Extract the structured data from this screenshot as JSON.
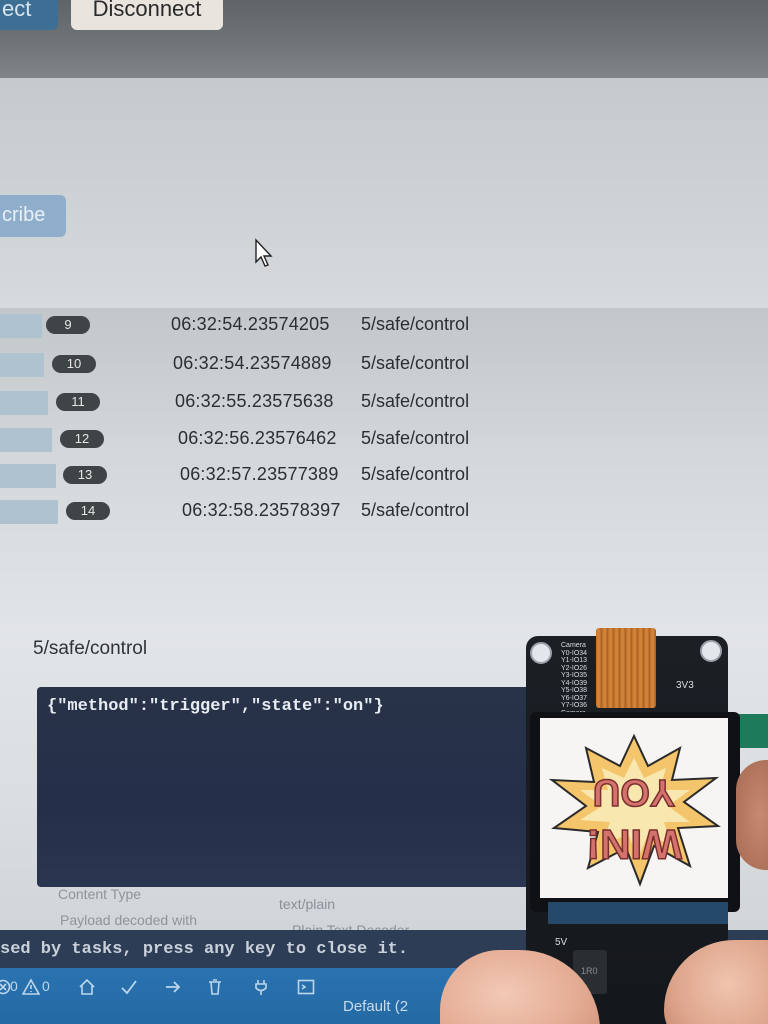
{
  "toolbar": {
    "connect_label": "ect",
    "disconnect_label": "Disconnect",
    "subscribe_label": "cribe"
  },
  "messages": [
    {
      "index": "9",
      "time": "06:32:54.23574205",
      "topic": "5/safe/control"
    },
    {
      "index": "10",
      "time": "06:32:54.23574889",
      "topic": "5/safe/control"
    },
    {
      "index": "11",
      "time": "06:32:55.23575638",
      "topic": "5/safe/control"
    },
    {
      "index": "12",
      "time": "06:32:56.23576462",
      "topic": "5/safe/control"
    },
    {
      "index": "13",
      "time": "06:32:57.23577389",
      "topic": "5/safe/control"
    },
    {
      "index": "14",
      "time": "06:32:58.23578397",
      "topic": "5/safe/control"
    }
  ],
  "payload": {
    "topic": "5/safe/control",
    "body": "{\"method\":\"trigger\",\"state\":\"on\"}",
    "content_type_label": "Content Type",
    "content_type_value": "text/plain",
    "decoded_label": "Payload decoded with",
    "decoded_value": "Plain Text Decoder"
  },
  "terminal": {
    "text": "sed by tasks, press any key to close it."
  },
  "statusbar": {
    "problems": "0",
    "warnings": "0",
    "profile": "Default (2"
  },
  "device": {
    "silk_camera": "Camera\nY0-IO34\nY1-IO13\nY2-IO26\nY3-IO35\nY4-IO39\nY5-IO38\nY6-IO37\nY7-IO36\nCamera",
    "silk_3v3": "3V3",
    "silk_5v": "5V",
    "chip_label": "1R0",
    "screen_text": "YOU WIN!"
  },
  "colors": {
    "accent_blue": "#3d6f94",
    "terminal_bg": "#2d3d55",
    "statusbar_bg": "#2a73b0",
    "index_badge": "#3f4447"
  }
}
